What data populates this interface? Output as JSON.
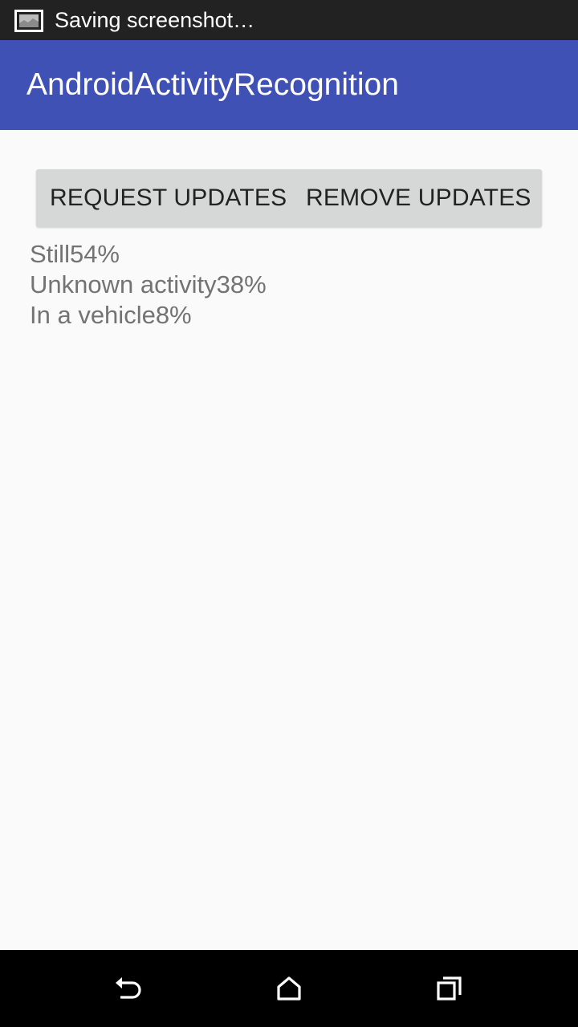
{
  "status_bar": {
    "notification_icon": "screenshot-icon",
    "text": "Saving screenshot…"
  },
  "app_bar": {
    "title": "AndroidActivityRecognition"
  },
  "buttons": {
    "request_label": "REQUEST UPDATES",
    "remove_label": "REMOVE UPDATES"
  },
  "activities": [
    "Still54%",
    "Unknown activity38%",
    "In a vehicle8%"
  ],
  "nav_bar": {
    "back_icon": "back-icon",
    "home_icon": "home-icon",
    "recents_icon": "recents-icon"
  },
  "colors": {
    "status_bar": "#222222",
    "app_bar": "#3f51b5",
    "background": "#fafafa",
    "button": "#d6d7d7",
    "activity_text": "#737373",
    "nav_bar": "#000000"
  }
}
